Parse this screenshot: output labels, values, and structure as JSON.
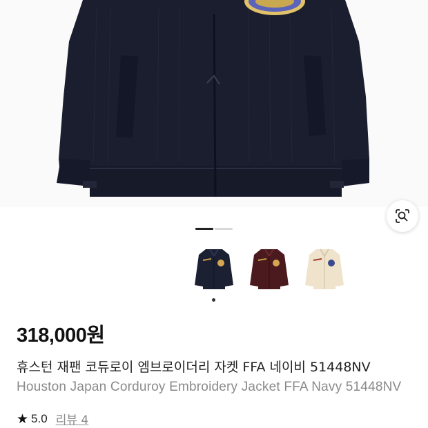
{
  "product": {
    "image_alt": "Houston corduroy embroidery jacket, navy",
    "gallery_pages": 2,
    "gallery_active_page": 1,
    "thumbnails": [
      {
        "name": "navy",
        "color": "#1c2033"
      },
      {
        "name": "burgundy",
        "color": "#4a1a1e"
      },
      {
        "name": "cream",
        "color": "#efe3cc"
      }
    ],
    "selected_thumbnail": 0,
    "price": "318,000원",
    "title_ko": "휴스턴 재팬 코듀로이 엠브로이더리 자켓 FFA 네이비 51448NV",
    "title_en": "Houston Japan Corduroy Embroidery Jacket FFA Navy 51448NV",
    "rating": "5.0",
    "review_label": "리뷰 4"
  },
  "icons": {
    "lens": "lens-search-icon",
    "star": "star-icon"
  },
  "colors": {
    "jacket": "#1b1e2e",
    "price": "#111111",
    "subtitle": "#8a8a8a"
  }
}
